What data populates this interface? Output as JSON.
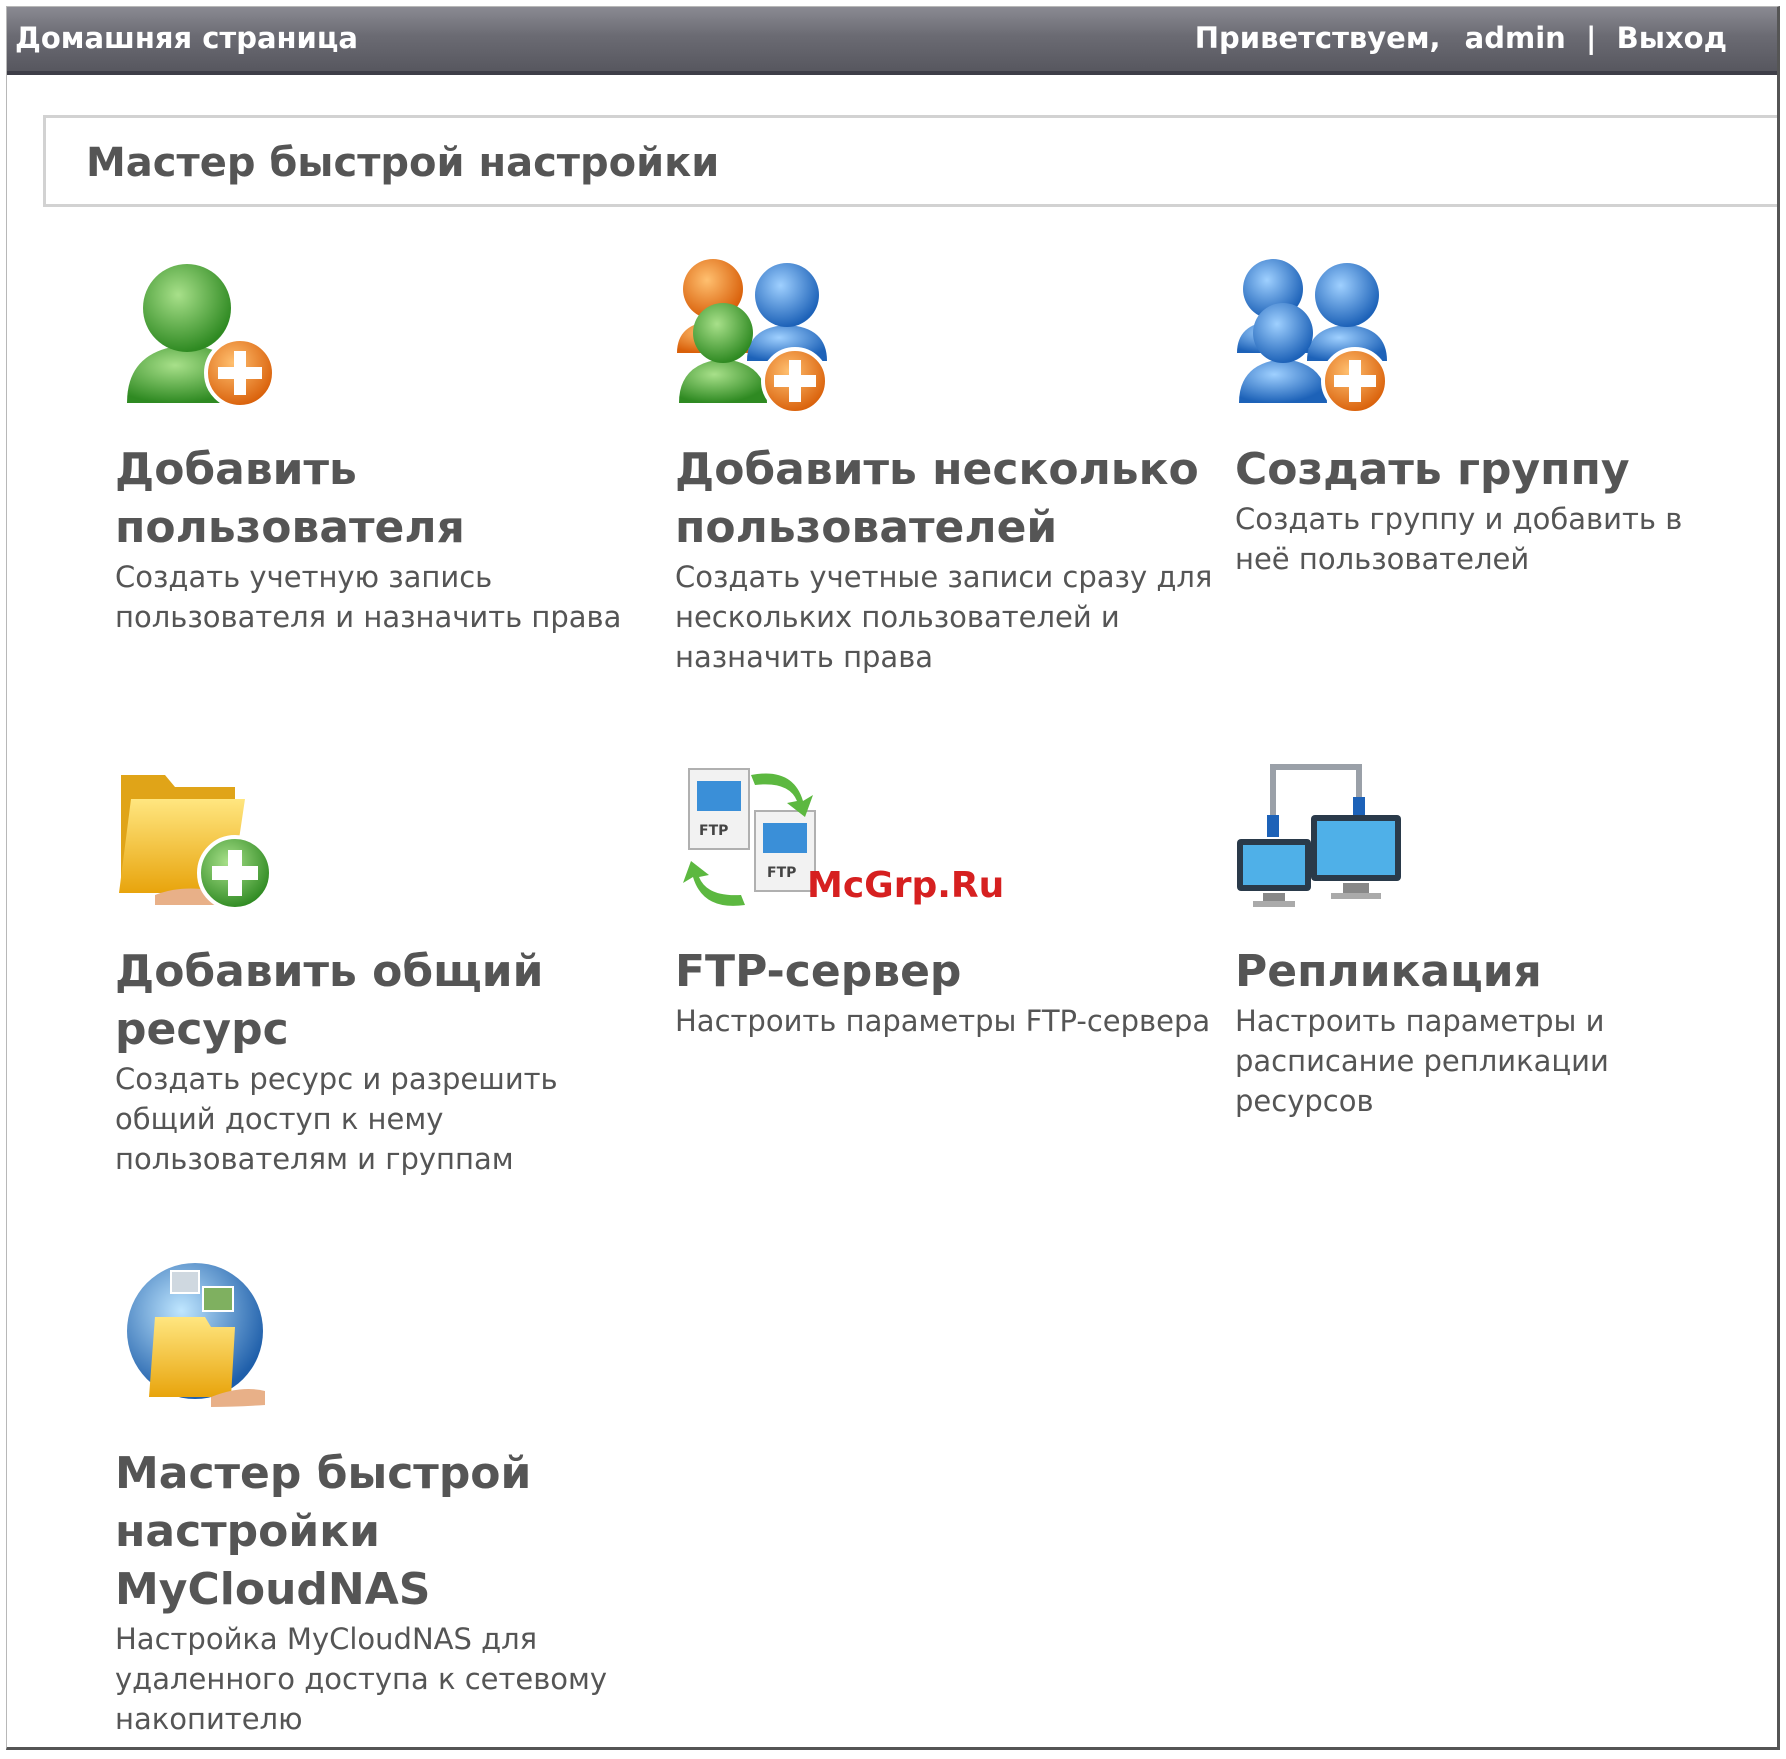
{
  "topbar": {
    "home_label": "Домашняя страница",
    "welcome": "Приветствуем,",
    "user": "admin",
    "separator": "|",
    "logout_label": "Выход"
  },
  "page": {
    "title": "Мастер быстрой настройки"
  },
  "cards": [
    {
      "icon": "add-user-icon",
      "title": "Добавить пользователя",
      "desc": "Создать учетную запись пользователя и назначить права"
    },
    {
      "icon": "add-multiple-users-icon",
      "title": "Добавить несколько пользователей",
      "desc": "Создать учетные записи сразу для нескольких пользователей и назначить права"
    },
    {
      "icon": "create-group-icon",
      "title": "Создать группу",
      "desc": "Создать группу и добавить в неё пользователей"
    },
    {
      "icon": "add-share-folder-icon",
      "title": "Добавить общий ресурс",
      "desc": "Создать ресурс и разрешить общий доступ к нему пользователям и группам"
    },
    {
      "icon": "ftp-server-icon",
      "title": "FTP-сервер",
      "desc": "Настроить параметры FTP-сервера"
    },
    {
      "icon": "replication-icon",
      "title": "Репликация",
      "desc": "Настроить параметры и расписание репликации ресурсов"
    },
    {
      "icon": "mycloudnas-globe-icon",
      "title": "Мастер быстрой настройки MyCloudNAS",
      "desc": "Настройка MyCloudNAS для удаленного доступа к сетевому накопителю"
    }
  ],
  "icon_labels": {
    "ftp": "FTP"
  },
  "watermark": "McGrp.Ru",
  "colors": {
    "topbar": "#6b6b73",
    "text": "#555555",
    "green": "#4caf3a",
    "blue": "#2f7fd0",
    "orange": "#f08a1c",
    "folder": "#f7c21a",
    "watermark": "#d62020"
  }
}
